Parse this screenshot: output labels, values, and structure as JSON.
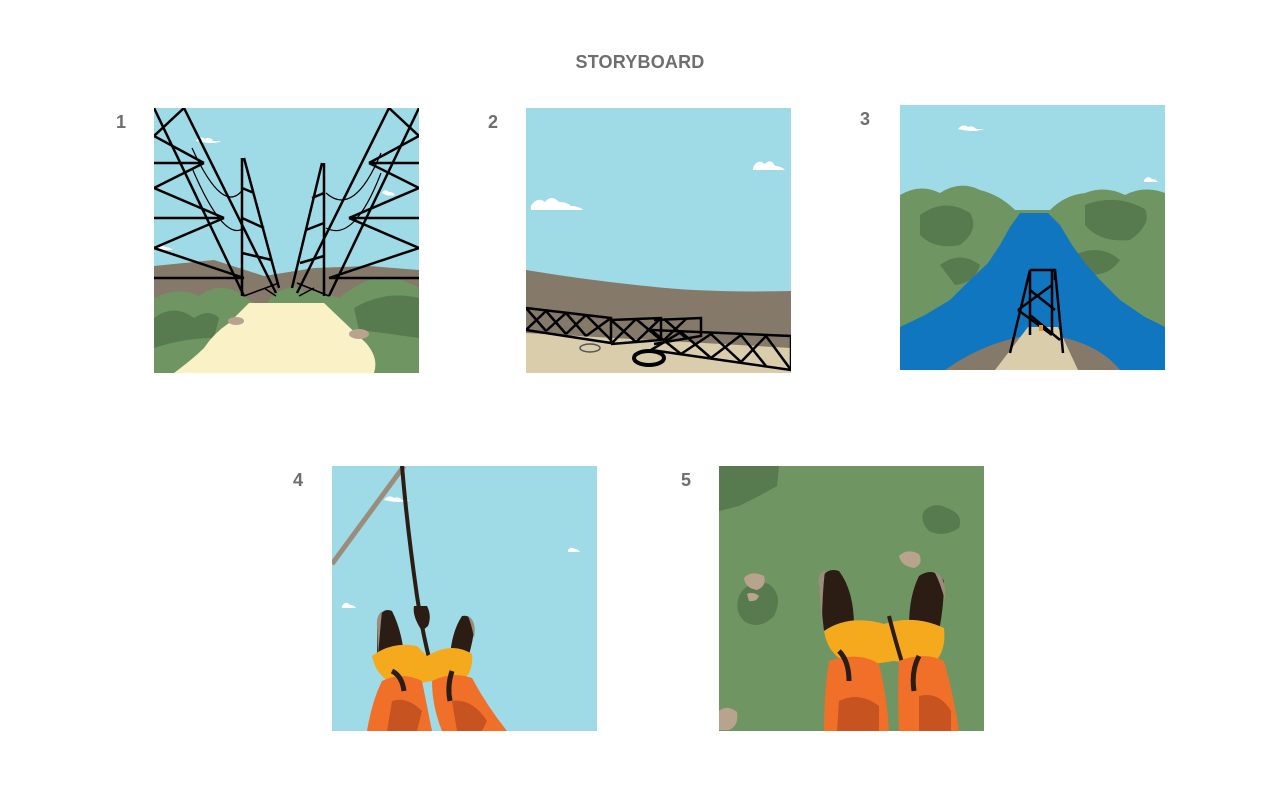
{
  "title": "STORYBOARD",
  "panels": [
    {
      "number": "1"
    },
    {
      "number": "2"
    },
    {
      "number": "3"
    },
    {
      "number": "4"
    },
    {
      "number": "5"
    }
  ],
  "colors": {
    "sky": "#9fdbe6",
    "hills": "#85796a",
    "foliage": "#6f9562",
    "foliage_dark": "#577a4f",
    "road": "#fbf1c6",
    "deck": "#d9cdab",
    "river": "#1076c0",
    "boot": "#2b1d14",
    "harness": "#f5a91c",
    "pants": "#f0702a",
    "label_gray": "#6e6e6e"
  }
}
